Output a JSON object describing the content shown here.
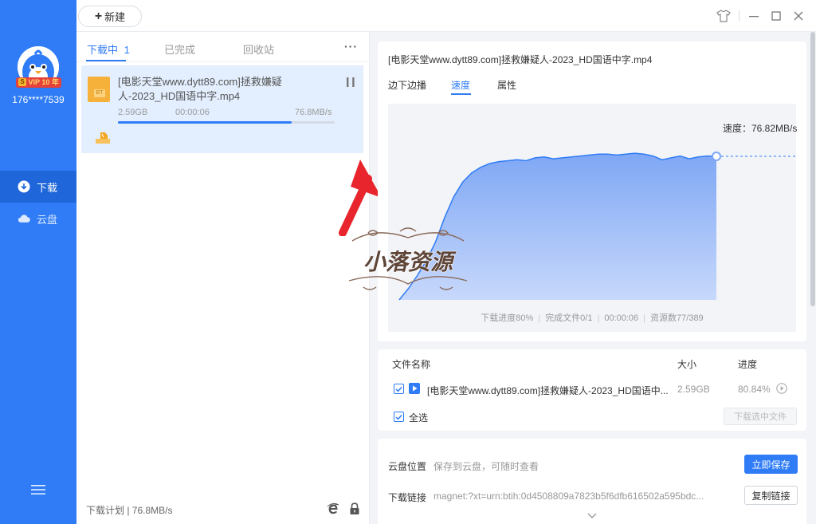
{
  "user": {
    "name": "176****7539",
    "vip_badge": "VIP 10 年",
    "vip_s": "S"
  },
  "nav": {
    "download": "下载",
    "cloud": "云盘"
  },
  "toolbar": {
    "new_label": "新建"
  },
  "tabs": {
    "downloading": "下载中",
    "downloading_count": "1",
    "completed": "已完成",
    "recycle": "回收站",
    "more": "···"
  },
  "task": {
    "name": "[电影天堂www.dytt89.com]拯救嫌疑人-2023_HD国语中字.mp4",
    "icon_text": "BT",
    "size": "2.59GB",
    "time": "00:00:06",
    "speed": "76.8MB/s",
    "progress": 0.8
  },
  "bottom": {
    "plan": "下载计划 | 76.8MB/s"
  },
  "detail": {
    "title": "[电影天堂www.dytt89.com]拯救嫌疑人-2023_HD国语中字.mp4",
    "tabs": [
      "边下边播",
      "速度",
      "属性"
    ],
    "speed_label": "速度：76.82MB/s",
    "stats": [
      "下载进度80%",
      "完成文件0/1",
      "00:00:06",
      "资源数77/389"
    ]
  },
  "chart_data": {
    "type": "area",
    "series": [
      {
        "values": [
          0,
          6,
          13,
          21,
          31,
          44,
          55,
          63,
          68,
          71,
          73,
          74,
          74.5,
          75,
          74.5,
          76,
          76.5,
          75.5,
          76,
          76.5,
          77,
          77.5,
          78,
          78,
          77.5,
          78,
          78.5,
          78,
          77,
          75,
          76,
          77,
          75.5,
          76.5,
          77,
          76.8
        ]
      }
    ],
    "current_value": 76.82,
    "unit": "MB/s",
    "ylim": [
      0,
      105
    ]
  },
  "files": {
    "headers": {
      "name": "文件名称",
      "size": "大小",
      "progress": "进度"
    },
    "rows": [
      {
        "name": "[电影天堂www.dytt89.com]拯救嫌疑人-2023_HD国语中...",
        "size": "2.59GB",
        "progress": "80.84%"
      }
    ],
    "select_all": "全选",
    "download_selected": "下载选中文件"
  },
  "cloud": {
    "location_label": "云盘位置",
    "location_hint": "保存到云盘，可随时查看",
    "save_button": "立即保存",
    "link_label": "下载链接",
    "link_value": "magnet:?xt=urn:btih:0d4508809a7823b5f6dfb616502a595bdc...",
    "copy_button": "复制链接"
  },
  "watermark": {
    "text": "小落资源"
  },
  "colors": {
    "accent": "#2f7cf6",
    "sidebar": "#2f7cf6",
    "annotation": "#e8242c"
  }
}
